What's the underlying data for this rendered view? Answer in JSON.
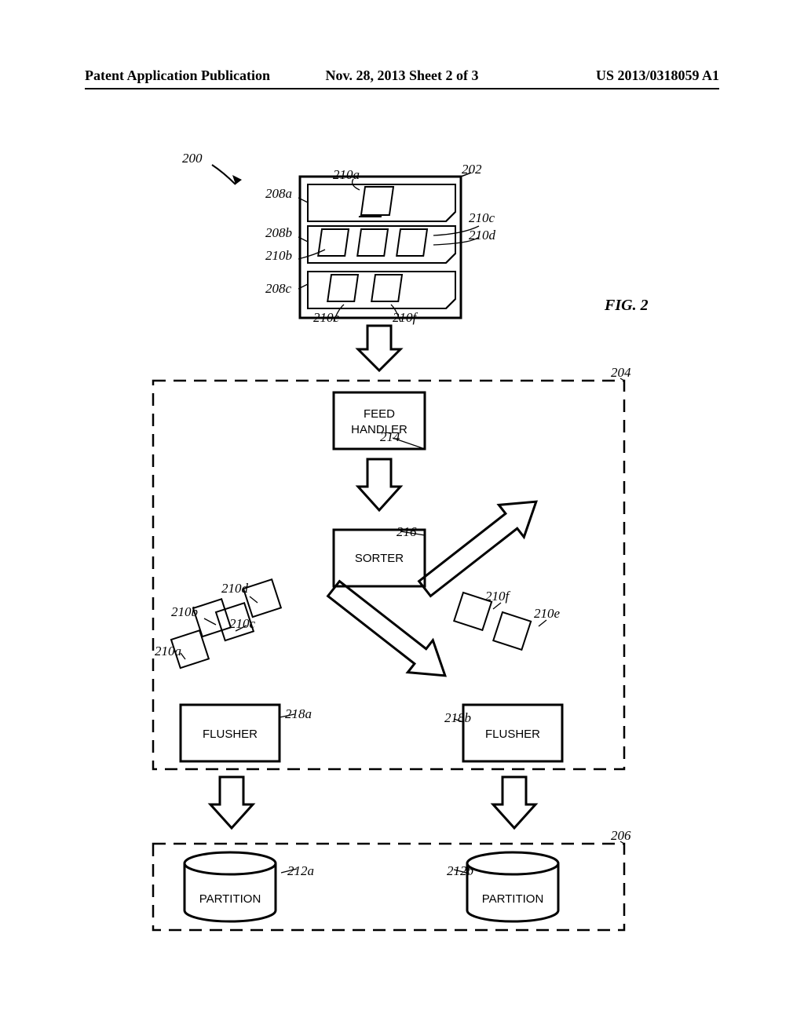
{
  "header": {
    "left": "Patent Application Publication",
    "center": "Nov. 28, 2013   Sheet 2 of 3",
    "right": "US 2013/0318059 A1"
  },
  "fig_caption": "FIG. 2",
  "labels": {
    "n200": "200",
    "n202": "202",
    "n204": "204",
    "n206": "206",
    "n208a": "208a",
    "n208b": "208b",
    "n208c": "208c",
    "n210a_top": "210a",
    "n210b_top": "210b",
    "n210c_top": "210c",
    "n210d_top": "210d",
    "n210e_top": "210e",
    "n210f_top": "210f",
    "n210a_bot": "210a",
    "n210b_bot": "210b",
    "n210c_bot": "210c",
    "n210d_bot": "210d",
    "n210e_bot": "210e",
    "n210f_bot": "210f",
    "n212a": "212a",
    "n212b": "212b",
    "n214": "214",
    "n216": "216",
    "n218a": "218a",
    "n218b": "218b"
  },
  "boxes": {
    "feed_handler_l1": "FEED",
    "feed_handler_l2": "HANDLER",
    "sorter": "SORTER",
    "flusher_a": "FLUSHER",
    "flusher_b": "FLUSHER",
    "partition_a": "PARTITION",
    "partition_b": "PARTITION"
  }
}
